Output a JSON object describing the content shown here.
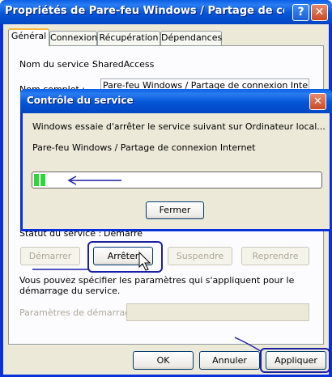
{
  "window": {
    "title": "Propriétés de Pare-feu Windows / Partage de connexi…"
  },
  "tabs": [
    {
      "label": "Général"
    },
    {
      "label": "Connexion"
    },
    {
      "label": "Récupération"
    },
    {
      "label": "Dépendances"
    }
  ],
  "general": {
    "service_name_label": "Nom du service :",
    "service_name_value": "SharedAccess",
    "display_name_label": "Nom complet :",
    "display_name_value": "Pare-feu Windows / Partage de connexion Internet",
    "status_label": "Statut du service :",
    "status_value": "Démarré",
    "start_button": "Démarrer",
    "stop_button": "Arrêter",
    "pause_button": "Suspendre",
    "resume_button": "Reprendre",
    "hint_text": "Vous pouvez spécifier les paramètres qui s'appliquent pour le démarrage du service.",
    "start_params_label": "Paramètres de démarrage :",
    "start_params_value": ""
  },
  "footer": {
    "ok": "OK",
    "cancel": "Annuler",
    "apply": "Appliquer"
  },
  "dialog": {
    "title": "Contrôle du service",
    "message": "Windows essaie d'arrêter le service suivant sur Ordinateur local...",
    "service": "Pare-feu Windows / Partage de connexion Internet",
    "progress_fraction": 0.04,
    "close_button": "Fermer"
  },
  "colors": {
    "xp_blue": "#0831d9",
    "annotation": "#1b1fa4",
    "progress_green": "#2fd63a"
  }
}
